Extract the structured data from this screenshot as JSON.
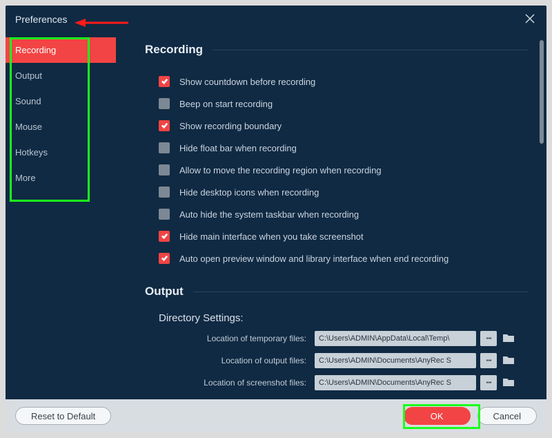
{
  "titlebar": {
    "title": "Preferences"
  },
  "sidebar": {
    "items": [
      {
        "label": "Recording",
        "active": true
      },
      {
        "label": "Output",
        "active": false
      },
      {
        "label": "Sound",
        "active": false
      },
      {
        "label": "Mouse",
        "active": false
      },
      {
        "label": "Hotkeys",
        "active": false
      },
      {
        "label": "More",
        "active": false
      }
    ]
  },
  "sections": {
    "recording": {
      "title": "Recording",
      "options": [
        {
          "label": "Show countdown before recording",
          "checked": true
        },
        {
          "label": "Beep on start recording",
          "checked": false
        },
        {
          "label": "Show recording boundary",
          "checked": true
        },
        {
          "label": "Hide float bar when recording",
          "checked": false
        },
        {
          "label": "Allow to move the recording region when recording",
          "checked": false
        },
        {
          "label": "Hide desktop icons when recording",
          "checked": false
        },
        {
          "label": "Auto hide the system taskbar when recording",
          "checked": false
        },
        {
          "label": "Hide main interface when you take screenshot",
          "checked": true
        },
        {
          "label": "Auto open preview window and library interface when end recording",
          "checked": true
        }
      ]
    },
    "output": {
      "title": "Output",
      "dir_heading": "Directory Settings:",
      "rows": [
        {
          "label": "Location of temporary files:",
          "value": "C:\\Users\\ADMIN\\AppData\\Local\\Temp\\"
        },
        {
          "label": "Location of output files:",
          "value": "C:\\Users\\ADMIN\\Documents\\AnyRec S"
        },
        {
          "label": "Location of screenshot files:",
          "value": "C:\\Users\\ADMIN\\Documents\\AnyRec S"
        }
      ]
    }
  },
  "footer": {
    "reset": "Reset to Default",
    "ok": "OK",
    "cancel": "Cancel"
  },
  "colors": {
    "bg": "#102a43",
    "accent": "#f24444",
    "highlight": "#1bff1b"
  },
  "glyphs": {
    "dots": "∙∙∙"
  }
}
